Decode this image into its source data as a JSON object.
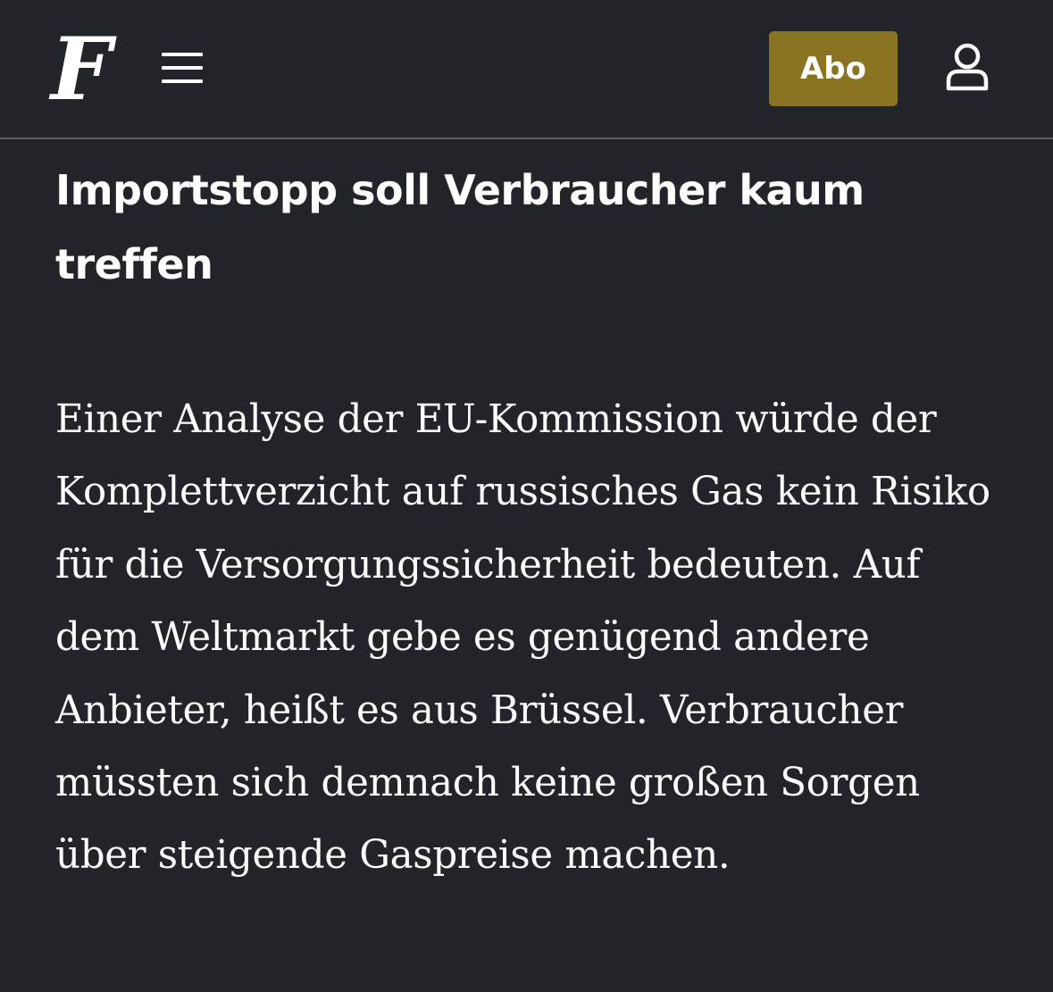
{
  "header": {
    "logo_letter": "F",
    "menu_icon": "hamburger-menu-icon",
    "abo_label": "Abo",
    "user_icon": "user-account-icon",
    "accent_color": "#8b7421",
    "background_color": "#212429"
  },
  "article": {
    "headline": "Importstopp soll Verbraucher kaum treffen",
    "teaser": "Einer Analyse der EU-Kommission würde der Komplettverzicht auf russisches Gas kein Risiko für die Versorgungssicherheit bedeuten. Auf dem Weltmarkt gebe es genügend andere Anbieter, heißt es aus Brüssel. Verbraucher müssten sich demnach keine großen Sorgen über steigende Gaspreise machen."
  }
}
